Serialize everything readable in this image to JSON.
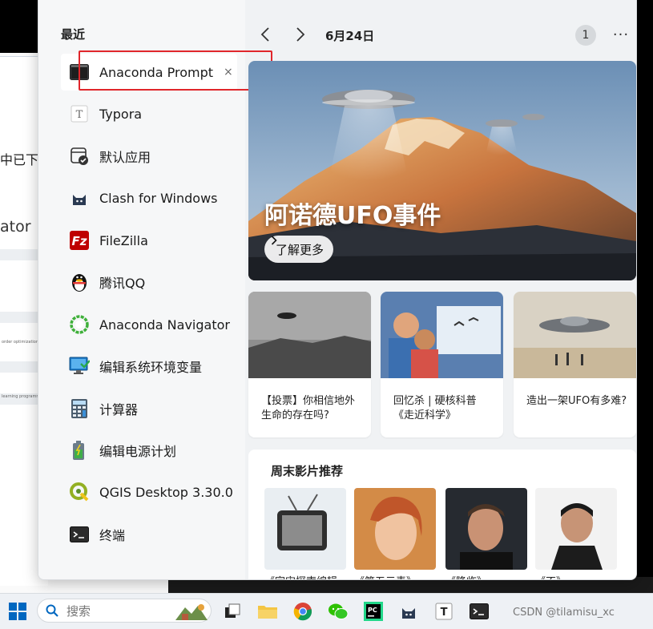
{
  "background": {
    "text_1": "中已下载",
    "text_2": "ator",
    "tiny_1": "order optimization.",
    "tiny_2": "learning programming"
  },
  "recent": {
    "title": "最近",
    "close_glyph": "×",
    "items": [
      {
        "label": "Anaconda Prompt",
        "icon": "terminal-icon"
      },
      {
        "label": "Typora",
        "icon": "typora-icon"
      },
      {
        "label": "默认应用",
        "icon": "default-apps-icon"
      },
      {
        "label": "Clash for Windows",
        "icon": "cat-icon"
      },
      {
        "label": "FileZilla",
        "icon": "filezilla-icon"
      },
      {
        "label": "腾讯QQ",
        "icon": "penguin-icon"
      },
      {
        "label": "Anaconda Navigator",
        "icon": "ring-icon"
      },
      {
        "label": "编辑系统环境变量",
        "icon": "monitor-icon"
      },
      {
        "label": "计算器",
        "icon": "calculator-icon"
      },
      {
        "label": "编辑电源计划",
        "icon": "battery-icon"
      },
      {
        "label": "QGIS Desktop 3.30.0",
        "icon": "qgis-icon"
      },
      {
        "label": "终端",
        "icon": "terminal-icon"
      }
    ]
  },
  "feed": {
    "date": "6月24日",
    "notification_count": "1",
    "more_glyph": "···",
    "hero": {
      "title": "阿诺德UFO事件",
      "button": "了解更多"
    },
    "cards": [
      {
        "text": "【投票】你相信地外生命的存在吗?"
      },
      {
        "text": "回忆杀 | 硬核科普《走近科学》"
      },
      {
        "text": "造出一架UFO有多难?"
      }
    ],
    "weekend": {
      "title": "周末影片推荐",
      "movies": [
        "《宇宙探索编辑",
        "《第五元素》",
        "《降临》",
        "《不》"
      ]
    }
  },
  "taskbar": {
    "search_placeholder": "搜索",
    "watermark": "CSDN @tilamisu_xc"
  },
  "colors": {
    "accent": "#0067c0",
    "highlight_border": "#e0262b",
    "panel_bg": "#f0f2f4"
  }
}
